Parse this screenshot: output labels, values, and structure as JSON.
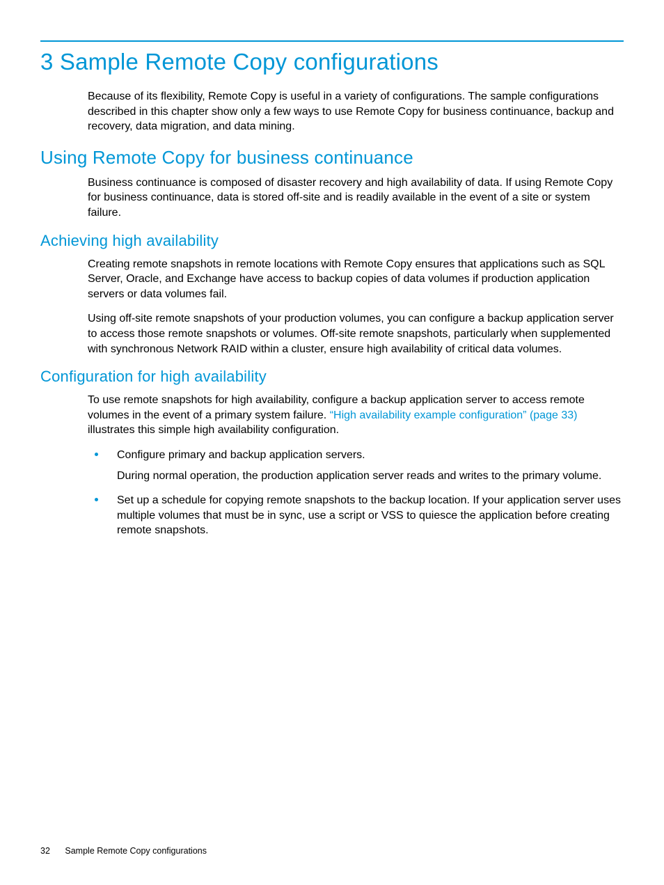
{
  "chapter": {
    "title": "3 Sample Remote Copy configurations",
    "intro": "Because of its flexibility, Remote Copy is useful in a variety of configurations. The sample configurations described in this chapter show only a few ways to use Remote Copy for business continuance, backup and recovery, data migration, and data mining."
  },
  "sections": {
    "business_continuance": {
      "heading": "Using Remote Copy for business continuance",
      "body": "Business continuance is composed of disaster recovery and high availability of data. If using Remote Copy for business continuance, data is stored off-site and is readily available in the event of a site or system failure."
    },
    "high_availability": {
      "heading": "Achieving high availability",
      "body1": "Creating remote snapshots in remote locations with Remote Copy ensures that applications such as SQL Server, Oracle, and Exchange have access to backup copies of data volumes if production application servers or data volumes fail.",
      "body2": "Using off-site remote snapshots of your production volumes, you can configure a backup application server to access those remote snapshots or volumes. Off-site remote snapshots, particularly when supplemented with synchronous Network RAID within a cluster, ensure high availability of critical data volumes."
    },
    "config_ha": {
      "heading": "Configuration for high availability",
      "intro_pre": "To use remote snapshots for high availability, configure a backup application server to access remote volumes in the event of a primary system failure. ",
      "link_text": "“High availability example configuration” (page 33)",
      "intro_post": " illustrates this simple high availability configuration.",
      "bullets": [
        {
          "text": "Configure primary and backup application servers.",
          "sub": "During normal operation, the production application server reads and writes to the primary volume."
        },
        {
          "text": "Set up a schedule for copying remote snapshots to the backup location. If your application server uses multiple volumes that must be in sync, use a script or VSS to quiesce the application before creating remote snapshots.",
          "sub": ""
        }
      ]
    }
  },
  "footer": {
    "page_number": "32",
    "section_label": "Sample Remote Copy configurations"
  }
}
